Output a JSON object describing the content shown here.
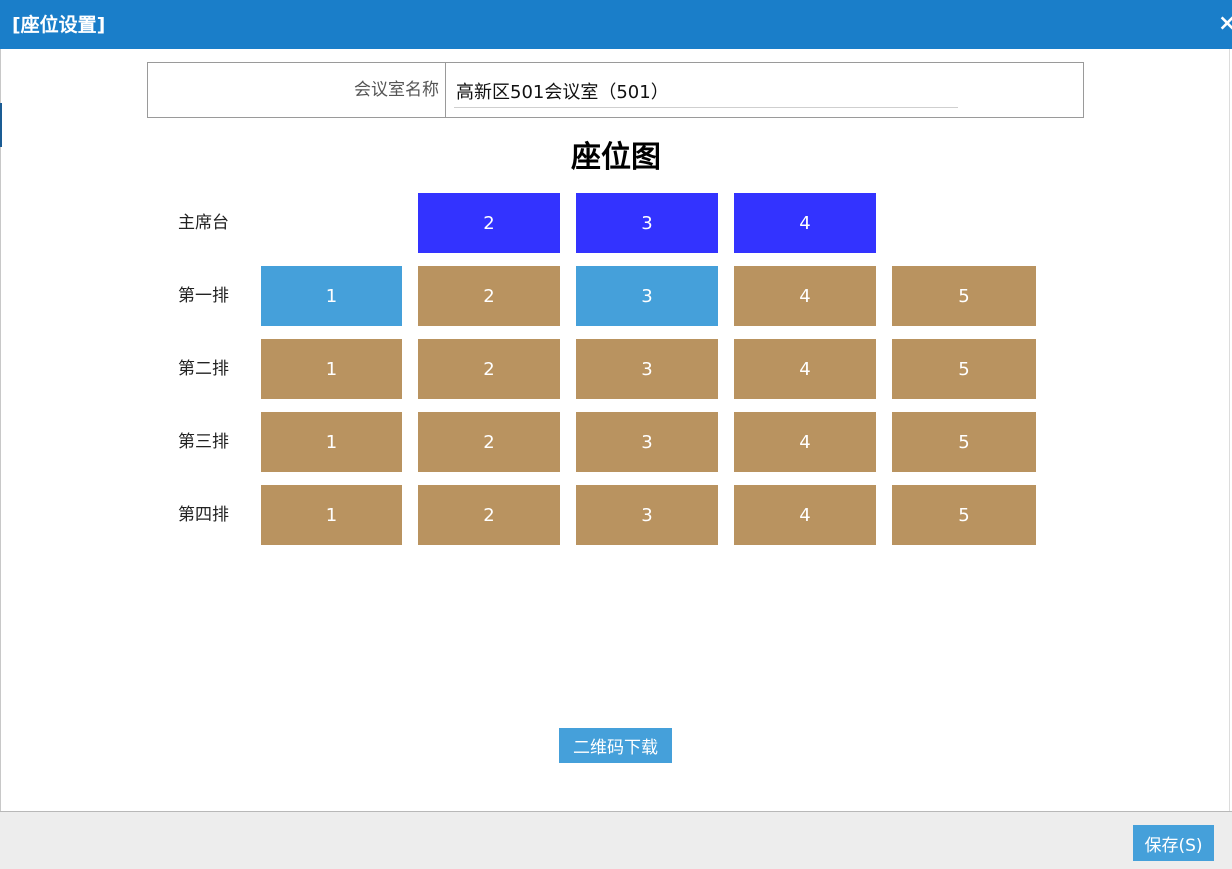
{
  "window": {
    "title": "[座位设置]",
    "close_glyph": "×"
  },
  "form": {
    "room_name_label": "会议室名称",
    "room_name_value": "高新区501会议室（501）"
  },
  "seat_map": {
    "title": "座位图",
    "rows": [
      {
        "label": "主席台",
        "seats": [
          {
            "number": "2",
            "state": "chair"
          },
          {
            "number": "3",
            "state": "chair"
          },
          {
            "number": "4",
            "state": "chair"
          }
        ]
      },
      {
        "label": "第一排",
        "seats": [
          {
            "number": "1",
            "state": "selected"
          },
          {
            "number": "2",
            "state": "available"
          },
          {
            "number": "3",
            "state": "selected"
          },
          {
            "number": "4",
            "state": "available"
          },
          {
            "number": "5",
            "state": "available"
          }
        ]
      },
      {
        "label": "第二排",
        "seats": [
          {
            "number": "1",
            "state": "available"
          },
          {
            "number": "2",
            "state": "available"
          },
          {
            "number": "3",
            "state": "available"
          },
          {
            "number": "4",
            "state": "available"
          },
          {
            "number": "5",
            "state": "available"
          }
        ]
      },
      {
        "label": "第三排",
        "seats": [
          {
            "number": "1",
            "state": "available"
          },
          {
            "number": "2",
            "state": "available"
          },
          {
            "number": "3",
            "state": "available"
          },
          {
            "number": "4",
            "state": "available"
          },
          {
            "number": "5",
            "state": "available"
          }
        ]
      },
      {
        "label": "第四排",
        "seats": [
          {
            "number": "1",
            "state": "available"
          },
          {
            "number": "2",
            "state": "available"
          },
          {
            "number": "3",
            "state": "available"
          },
          {
            "number": "4",
            "state": "available"
          },
          {
            "number": "5",
            "state": "available"
          }
        ]
      }
    ]
  },
  "actions": {
    "qr_download_label": "二维码下载",
    "save_label": "保存(S)"
  },
  "colors": {
    "titlebar": "#1a7ec9",
    "chair_seat": "#3333ff",
    "available_seat": "#b99360",
    "selected_seat": "#45a0da",
    "button": "#45a0da"
  }
}
